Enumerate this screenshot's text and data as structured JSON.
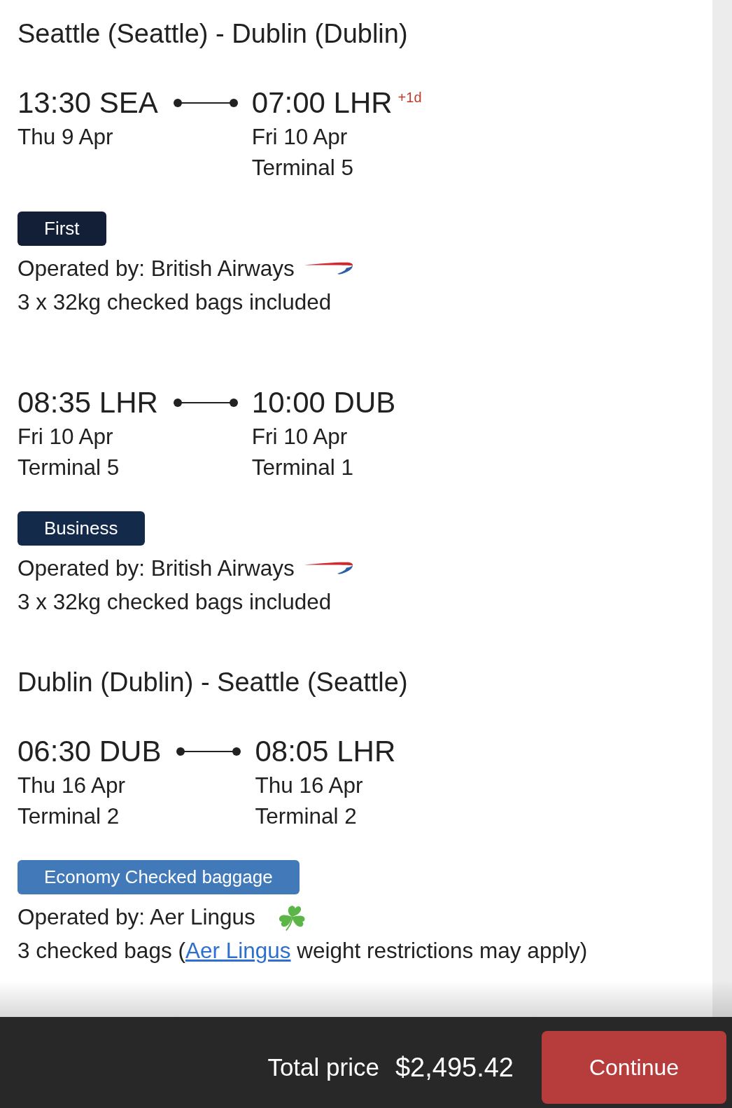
{
  "journeys": [
    {
      "title": "Seattle (Seattle) - Dublin (Dublin)",
      "segments": [
        {
          "departure": {
            "time": "13:30 SEA",
            "date": "Thu 9 Apr"
          },
          "arrival": {
            "time": "07:00 LHR",
            "day_offset": "+1d",
            "date": "Fri 10 Apr",
            "terminal": "Terminal 5"
          },
          "cabin": {
            "label": "First",
            "color": "#131f37"
          },
          "operator": {
            "text": "Operated by: British Airways",
            "kind": "swoosh"
          },
          "baggage": {
            "text": "3 x 32kg checked bags included"
          }
        },
        {
          "departure": {
            "time": "08:35 LHR",
            "date": "Fri 10 Apr",
            "terminal": "Terminal 5"
          },
          "arrival": {
            "time": "10:00 DUB",
            "date": "Fri 10 Apr",
            "terminal": "Terminal 1"
          },
          "cabin": {
            "label": "Business",
            "color": "#142a4b"
          },
          "operator": {
            "text": "Operated by: British Airways",
            "kind": "swoosh"
          },
          "baggage": {
            "text": "3 x 32kg checked bags included"
          }
        }
      ]
    },
    {
      "title": "Dublin (Dublin) - Seattle (Seattle)",
      "segments": [
        {
          "departure": {
            "time": "06:30 DUB",
            "date": "Thu 16 Apr",
            "terminal": "Terminal 2"
          },
          "arrival": {
            "time": "08:05 LHR",
            "date": "Thu 16 Apr",
            "terminal": "Terminal 2"
          },
          "cabin": {
            "label": "Economy Checked baggage",
            "color": "#4279b8"
          },
          "operator": {
            "text": "Operated by: Aer Lingus",
            "kind": "shamrock"
          },
          "baggage": {
            "text": "3 checked bags (",
            "link": "Aer Lingus",
            "after": " weight restrictions may apply)"
          }
        }
      ]
    }
  ],
  "footer": {
    "total_label": "Total price",
    "total": "$2,495.42",
    "button": "Continue"
  }
}
